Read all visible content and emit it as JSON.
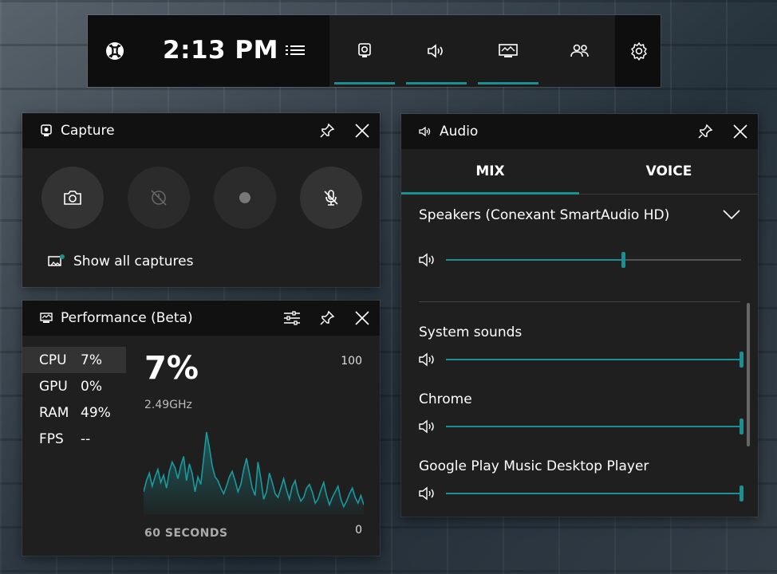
{
  "topbar": {
    "time": "2:13 PM",
    "widgets": [
      "capture-icon",
      "audio-icon",
      "performance-icon",
      "social-icon"
    ]
  },
  "capture": {
    "title": "Capture",
    "show_all": "Show all captures"
  },
  "performance": {
    "title": "Performance (Beta)",
    "stats": [
      {
        "name": "CPU",
        "value": "7%"
      },
      {
        "name": "GPU",
        "value": "0%"
      },
      {
        "name": "RAM",
        "value": "49%"
      },
      {
        "name": "FPS",
        "value": "--"
      }
    ],
    "current": "7%",
    "frequency": "2.49GHz",
    "axis_max": "100",
    "axis_min": "0",
    "window_label": "60 SECONDS",
    "history": [
      12,
      18,
      22,
      15,
      20,
      24,
      17,
      21,
      14,
      23,
      28,
      25,
      19,
      26,
      31,
      18,
      27,
      22,
      12,
      20,
      16,
      30,
      44,
      36,
      26,
      20,
      18,
      14,
      11,
      15,
      20,
      23,
      18,
      12,
      16,
      24,
      30,
      22,
      14,
      10,
      28,
      19,
      8,
      12,
      22,
      17,
      11,
      9,
      14,
      19,
      13,
      8,
      15,
      18,
      11,
      7,
      9,
      14,
      16,
      12,
      6,
      8,
      13,
      17,
      10,
      5,
      9,
      12,
      15,
      8,
      4,
      7,
      11,
      14,
      9,
      6,
      10,
      5
    ]
  },
  "audio": {
    "title": "Audio",
    "tabs": [
      {
        "label": "MIX"
      },
      {
        "label": "VOICE"
      }
    ],
    "device": "Speakers (Conexant SmartAudio HD)",
    "device_volume": 0.6,
    "apps": [
      {
        "name": "System sounds",
        "volume": 1.0
      },
      {
        "name": "Chrome",
        "volume": 1.0
      },
      {
        "name": "Google Play Music Desktop Player",
        "volume": 1.0
      }
    ]
  },
  "colors": {
    "accent": "#1b8f92",
    "panel": "#1f1f1f",
    "titlebar": "#111111"
  }
}
